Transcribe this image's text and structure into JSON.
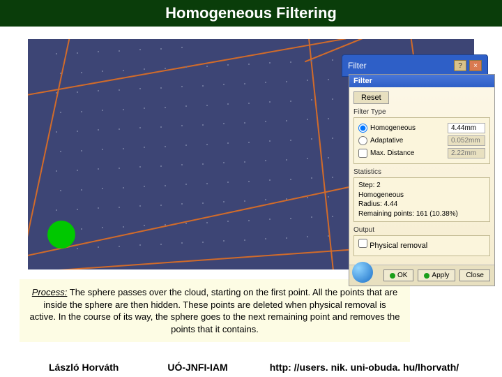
{
  "title": "Homogeneous Filtering",
  "back_dialog_title": "Filter",
  "dialog": {
    "title": "Filter",
    "reset": "Reset",
    "filter_type_label": "Filter Type",
    "homogeneous": {
      "label": "Homogeneous",
      "value": "4.44mm"
    },
    "adaptive": {
      "label": "Adaptative",
      "value": "0.052mm"
    },
    "max_distance": {
      "label": "Max. Distance",
      "value": "2.22mm"
    },
    "statistics_label": "Statistics",
    "statistics": "Step: 2\nHomogeneous\nRadius: 4.44\nRemaining points: 161 (10.38%)",
    "output_label": "Output",
    "physical_removal": "Physical removal",
    "ok": "OK",
    "apply": "Apply",
    "close": "Close"
  },
  "process": {
    "label": "Process:",
    "text": " The sphere passes over the cloud, starting on the first point. All the points that are inside the sphere are then hidden. These points are deleted when physical removal is active. In the course of its way, the sphere goes to the next remaining point and removes the points that it contains."
  },
  "footer": {
    "author": "László Horváth",
    "org": "UÓ-JNFI-IAM",
    "url": "http: //users. nik. uni-obuda. hu/lhorvath/"
  }
}
